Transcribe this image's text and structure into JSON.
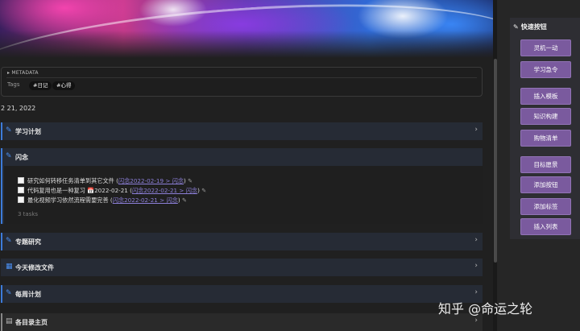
{
  "metadata": {
    "header": "▸ METADATA",
    "key": "Tags",
    "tags": [
      "#日记",
      "#心得"
    ]
  },
  "date_text": "2 21, 2022",
  "callouts": [
    {
      "title": "学习计划",
      "icon": "pencil-icon"
    },
    {
      "title": "闪念",
      "icon": "pencil-icon"
    },
    {
      "title": "专题研究",
      "icon": "pencil-icon"
    },
    {
      "title": "今天修改文件",
      "icon": "calendar-icon"
    },
    {
      "title": "每周计划",
      "icon": "pencil-icon"
    },
    {
      "title": "各目录主页",
      "icon": "document-icon"
    }
  ],
  "tasks": [
    {
      "text": "研究如何转移任务清单到其它文件 (",
      "link": "闪念2022-02-19 > 闪念",
      "tail": ")"
    },
    {
      "text": "代码复用也是一种复习 📅2022-02-21 (",
      "link": "闪念2022-02-21 > 闪念",
      "tail": ")"
    },
    {
      "text": "最化视频学习依然流程需要完善 (",
      "link": "闪念2022-02-21 > 闪念",
      "tail": ")"
    }
  ],
  "task_count": "3 tasks",
  "quick_panel": {
    "title": "快速按钮",
    "buttons": [
      "灵机一动",
      "学习急令",
      "插入模板",
      "知识构建",
      "购物清单",
      "目标愿景",
      "添加按钮",
      "添加标签",
      "插入列表"
    ]
  },
  "watermark": "知乎 @命运之轮",
  "colors": {
    "accent": "#3d7bd9",
    "button": "#7a5a9e",
    "link": "#8c7fd8"
  }
}
